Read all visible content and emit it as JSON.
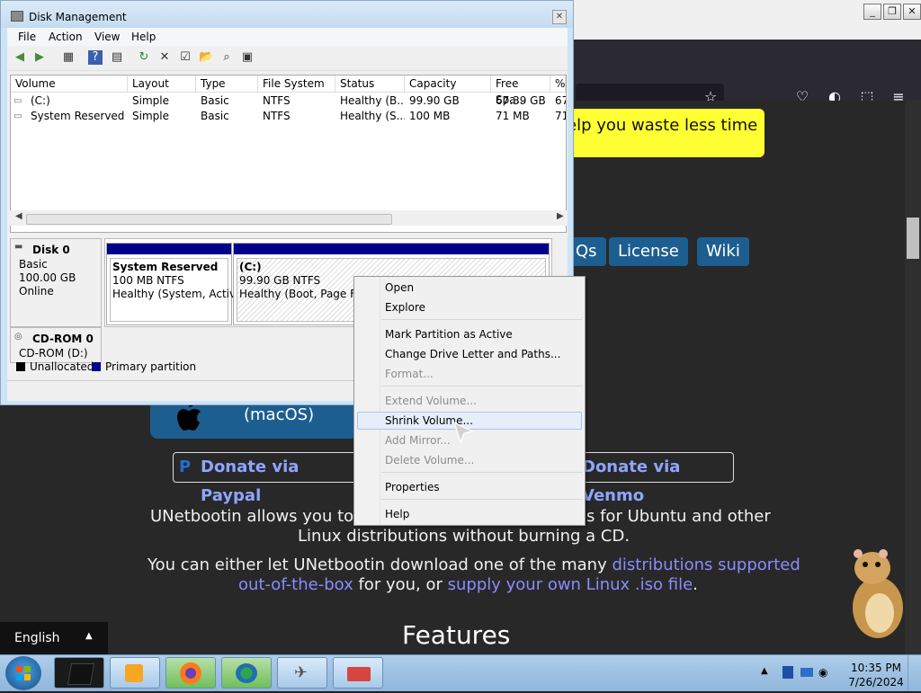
{
  "browser": {
    "banner_text": "elp you waste less time",
    "nav_buttons": [
      "Qs",
      "License",
      "Wiki"
    ],
    "download_label": "(macOS)",
    "donate_paypal": "Donate via Paypal",
    "donate_venmo": "Donate via Venmo",
    "para1_line1a": "UNetbootin allows you to c",
    "para1_line1b": "s for Ubuntu and other",
    "para1_line2": "Linux distributions without burning a CD.",
    "para2_line1a": "You can either let UNetbootin download one of the many ",
    "para2_link1a": "distributions supported",
    "para2_link1b": "out-of-the-box",
    "para2_line2b": " for you, or ",
    "para2_link2": "supply your own Linux .iso file",
    "para2_line2c": ".",
    "features_heading": "Features",
    "language": "English"
  },
  "disk_management": {
    "title": "Disk Management",
    "menu": [
      "File",
      "Action",
      "View",
      "Help"
    ],
    "columns": [
      "Volume",
      "Layout",
      "Type",
      "File System",
      "Status",
      "Capacity",
      "Free Spa...",
      "%"
    ],
    "volumes": [
      {
        "volume": "(C:)",
        "layout": "Simple",
        "type": "Basic",
        "fs": "NTFS",
        "status": "Healthy (B...",
        "capacity": "99.90 GB",
        "free": "67.39 GB",
        "pct": "67"
      },
      {
        "volume": "System Reserved",
        "layout": "Simple",
        "type": "Basic",
        "fs": "NTFS",
        "status": "Healthy (S...",
        "capacity": "100 MB",
        "free": "71 MB",
        "pct": "71"
      }
    ],
    "disk0": {
      "name": "Disk 0",
      "type": "Basic",
      "size": "100.00 GB",
      "state": "Online",
      "partitions": [
        {
          "name": "System Reserved",
          "size": "100 MB NTFS",
          "status": "Healthy (System, Active"
        },
        {
          "name": "(C:)",
          "size": "99.90 GB NTFS",
          "status": "Healthy (Boot, Page File,"
        }
      ]
    },
    "cdrom": {
      "name": "CD-ROM 0",
      "drive": "CD-ROM (D:)"
    },
    "legend": {
      "unallocated": "Unallocated",
      "primary": "Primary partition"
    }
  },
  "context_menu": {
    "items": [
      {
        "label": "Open",
        "enabled": true
      },
      {
        "label": "Explore",
        "enabled": true
      },
      {
        "label": "Mark Partition as Active",
        "enabled": true
      },
      {
        "label": "Change Drive Letter and Paths...",
        "enabled": true
      },
      {
        "label": "Format...",
        "enabled": false
      },
      {
        "label": "Extend Volume...",
        "enabled": false
      },
      {
        "label": "Shrink Volume...",
        "enabled": true,
        "highlighted": true
      },
      {
        "label": "Add Mirror...",
        "enabled": false
      },
      {
        "label": "Delete Volume...",
        "enabled": false
      },
      {
        "label": "Properties",
        "enabled": true
      },
      {
        "label": "Help",
        "enabled": true
      }
    ]
  },
  "taskbar": {
    "time": "10:35 PM",
    "date": "7/26/2024"
  }
}
